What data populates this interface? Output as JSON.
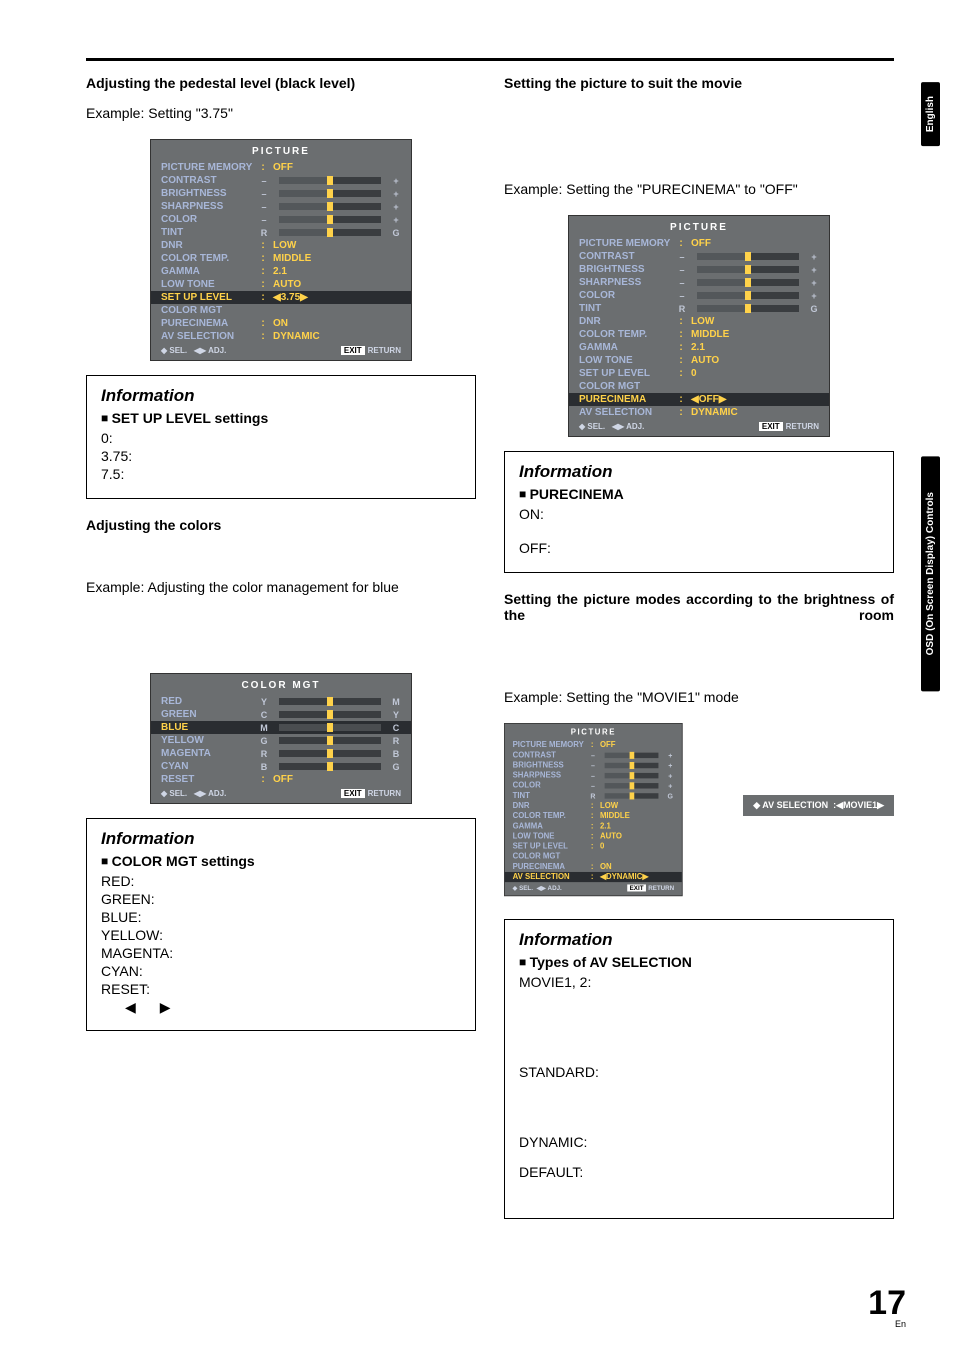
{
  "side_tabs": {
    "t1": "English",
    "t2": "OSD (On Screen Display) Controls"
  },
  "page_number": "17",
  "page_lang": "En",
  "left": {
    "h1": "Adjusting the pedestal level (black level)",
    "ex1": "Example: Setting \"3.75\"",
    "h2": "Adjusting the colors",
    "ex2": "Example: Adjusting the color management for blue",
    "info1": {
      "hdr": "Information",
      "sub": "SET UP LEVEL settings",
      "l1": "0:",
      "l2": "3.75:",
      "l3": "7.5:"
    },
    "info2": {
      "hdr": "Information",
      "sub": "COLOR MGT settings",
      "l1": "RED:",
      "l2": "GREEN:",
      "l3": "BLUE:",
      "l4": "YELLOW:",
      "l5": "MAGENTA:",
      "l6": "CYAN:",
      "l7": "RESET:",
      "arrows": "◀▶"
    }
  },
  "right": {
    "h1": "Setting the picture to suit the movie",
    "ex1": "Example: Setting the \"PURECINEMA\" to \"OFF\"",
    "h2": "Setting the picture modes according to the brightness of the room",
    "ex2": "Example: Setting the \"MOVIE1\" mode",
    "info1": {
      "hdr": "Information",
      "sub": "PURECINEMA",
      "l1": "ON:",
      "l2": "OFF:"
    },
    "info2": {
      "hdr": "Information",
      "sub": "Types of AV SELECTION",
      "l1": "MOVIE1, 2:",
      "l2": "STANDARD:",
      "l3": "DYNAMIC:",
      "l4": "DEFAULT:"
    },
    "av_popup_label": "AV SELECTION",
    "av_popup_value": "MOVIE1"
  },
  "osd_picture": {
    "title": "PICTURE",
    "rows": {
      "picture_memory": {
        "lab": "PICTURE MEMORY",
        "val": "OFF"
      },
      "contrast": "CONTRAST",
      "brightness": "BRIGHTNESS",
      "sharpness": "SHARPNESS",
      "color": "COLOR",
      "tint": "TINT",
      "dnr": {
        "lab": "DNR",
        "val": "LOW"
      },
      "color_temp": {
        "lab": "COLOR TEMP.",
        "val": "MIDDLE"
      },
      "gamma": {
        "lab": "GAMMA",
        "val": "2.1"
      },
      "low_tone": {
        "lab": "LOW TONE",
        "val": "AUTO"
      },
      "set_up_level_375": {
        "lab": "SET UP LEVEL",
        "val": "3.75"
      },
      "set_up_level_0": {
        "lab": "SET UP LEVEL",
        "val": "0"
      },
      "color_mgt": "COLOR MGT",
      "purecinema_on": {
        "lab": "PURECINEMA",
        "val": "ON"
      },
      "purecinema_off": {
        "lab": "PURECINEMA",
        "val": "OFF"
      },
      "av_selection_dyn": {
        "lab": "AV SELECTION",
        "val": "DYNAMIC"
      }
    },
    "footer": {
      "sel": "SEL.",
      "adj": "ADJ.",
      "exit": "EXIT",
      "ret": "RETURN"
    },
    "caps": {
      "minus": "–",
      "plus": "+",
      "R": "R",
      "G": "G"
    }
  },
  "osd_colormgt": {
    "title": "COLOR MGT",
    "rows": {
      "red": {
        "lab": "RED",
        "l": "Y",
        "r": "M"
      },
      "green": {
        "lab": "GREEN",
        "l": "C",
        "r": "Y"
      },
      "blue": {
        "lab": "BLUE",
        "l": "M",
        "r": "C"
      },
      "yellow": {
        "lab": "YELLOW",
        "l": "G",
        "r": "R"
      },
      "magenta": {
        "lab": "MAGENTA",
        "l": "R",
        "r": "B"
      },
      "cyan": {
        "lab": "CYAN",
        "l": "B",
        "r": "G"
      },
      "reset": {
        "lab": "RESET",
        "val": "OFF"
      }
    }
  }
}
